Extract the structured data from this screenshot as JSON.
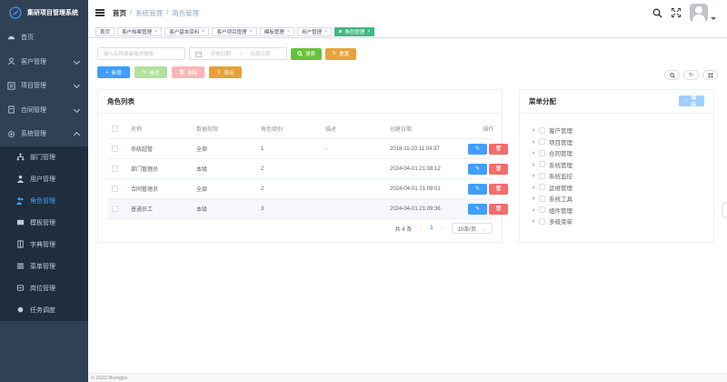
{
  "app": {
    "title": "集研项目管理系统"
  },
  "sidebar": {
    "items": [
      {
        "label": "首页",
        "icon": "dashboard-icon",
        "expandable": false
      },
      {
        "label": "客户管理",
        "icon": "users-icon",
        "expandable": true
      },
      {
        "label": "项目管理",
        "icon": "list-icon",
        "expandable": true
      },
      {
        "label": "合同管理",
        "icon": "contract-icon",
        "expandable": true
      },
      {
        "label": "系统管理",
        "icon": "gear-icon",
        "expandable": true
      }
    ],
    "submenu": [
      {
        "label": "部门管理",
        "icon": "tree-icon",
        "active": false
      },
      {
        "label": "用户管理",
        "icon": "user-icon",
        "active": false
      },
      {
        "label": "角色管理",
        "icon": "peoples-icon",
        "active": true
      },
      {
        "label": "模板管理",
        "icon": "template-icon",
        "active": false
      },
      {
        "label": "字典管理",
        "icon": "dict-icon",
        "active": false
      },
      {
        "label": "菜单管理",
        "icon": "menu-icon",
        "active": false
      },
      {
        "label": "岗位管理",
        "icon": "post-icon",
        "active": false
      },
      {
        "label": "任务调度",
        "icon": "job-icon",
        "active": false
      }
    ]
  },
  "breadcrumb": {
    "items": [
      "首页",
      "系统管理",
      "角色管理"
    ],
    "separator": "/"
  },
  "tags": [
    {
      "label": "首页",
      "closable": false,
      "active": false
    },
    {
      "label": "客户档案管理",
      "closable": true,
      "active": false
    },
    {
      "label": "客户基本资料",
      "closable": true,
      "active": false
    },
    {
      "label": "客户项目管理",
      "closable": true,
      "active": false
    },
    {
      "label": "模板管理",
      "closable": true,
      "active": false
    },
    {
      "label": "用户管理",
      "closable": true,
      "active": false
    },
    {
      "label": "角色管理",
      "closable": true,
      "active": true
    }
  ],
  "search": {
    "name_placeholder": "输入名称或者描述搜索",
    "start_placeholder": "开始日期",
    "range_sep": ":",
    "end_placeholder": "结束日期",
    "search_label": "搜索",
    "reset_label": "重置"
  },
  "actions": {
    "add": "新增",
    "edit": "修改",
    "delete": "删除",
    "export": "导出"
  },
  "roles_card": {
    "title": "角色列表",
    "columns": [
      "名称",
      "数据权限",
      "角色级别",
      "描述",
      "创建日期",
      "操作"
    ],
    "rows": [
      {
        "name": "系统超管",
        "scope": "全部",
        "level": "1",
        "desc": "-",
        "created": "2018-11-23 11:04:37"
      },
      {
        "name": "部门管理员",
        "scope": "本级",
        "level": "2",
        "desc": "",
        "created": "2024-04-01 21:08:12"
      },
      {
        "name": "合同管理员",
        "scope": "全部",
        "level": "2",
        "desc": "",
        "created": "2024-04-01 21:09:01"
      },
      {
        "name": "普通员工",
        "scope": "本级",
        "level": "3",
        "desc": "",
        "created": "2024-04-01 21:09:36"
      }
    ],
    "pagination": {
      "total": "共 4 条",
      "current": "1",
      "page_size": "10条/页"
    }
  },
  "menu_card": {
    "title": "菜单分配",
    "save_label": "保存",
    "nodes": [
      "客户管理",
      "项目管理",
      "合同管理",
      "系统管理",
      "系统监控",
      "运维管理",
      "系统工具",
      "组件管理",
      "多级菜单"
    ]
  },
  "footer": {
    "text": "© 2022 lihongbo"
  },
  "colors": {
    "sidebar_bg": "#304156",
    "primary": "#409eff",
    "success": "#67c23a",
    "warning": "#e6a23c",
    "danger": "#f56c6c",
    "tag_active": "#42b983"
  }
}
